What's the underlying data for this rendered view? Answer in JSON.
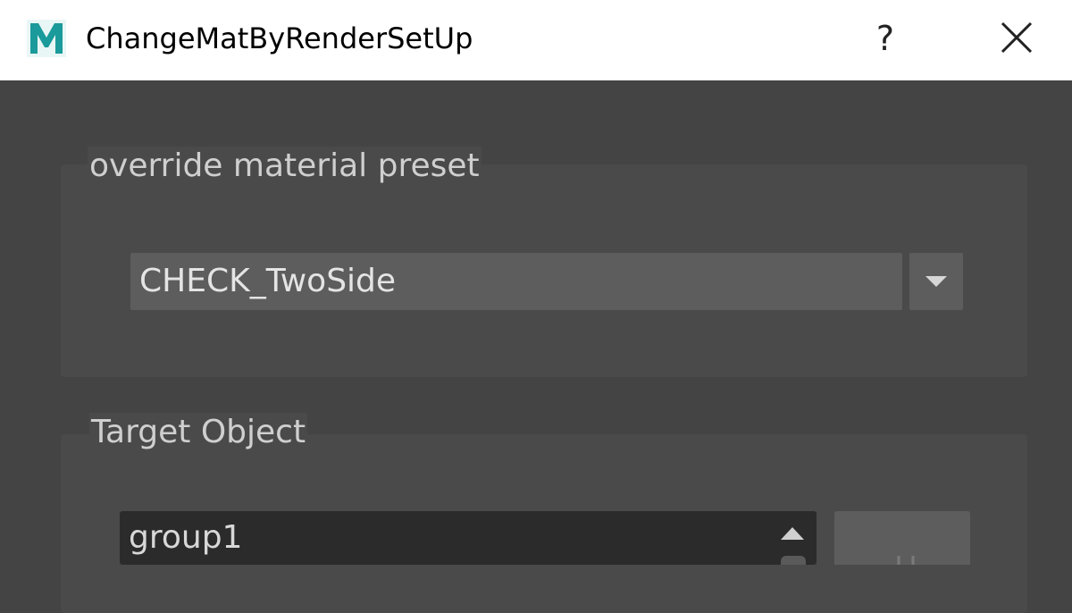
{
  "window": {
    "title": "ChangeMatByRenderSetUp",
    "help_label": "?",
    "app_icon": "maya-m-icon",
    "close_icon": "close-x-icon"
  },
  "preset_group": {
    "label": "override material preset",
    "combo_value": "CHECK_TwoSide",
    "combo_icon": "chevron-down-icon"
  },
  "target_group": {
    "label": "Target Object",
    "list_items": [
      "group1"
    ],
    "scroll_icon": "scroll-up-arrow-icon"
  },
  "colors": {
    "window_bg": "#444444",
    "title_bar": "#ffffff",
    "group_bg": "#4a4a4a",
    "field_bg": "#5d5d5d",
    "list_bg": "#2b2b2b",
    "icon_teal": "#1a9a9a"
  }
}
